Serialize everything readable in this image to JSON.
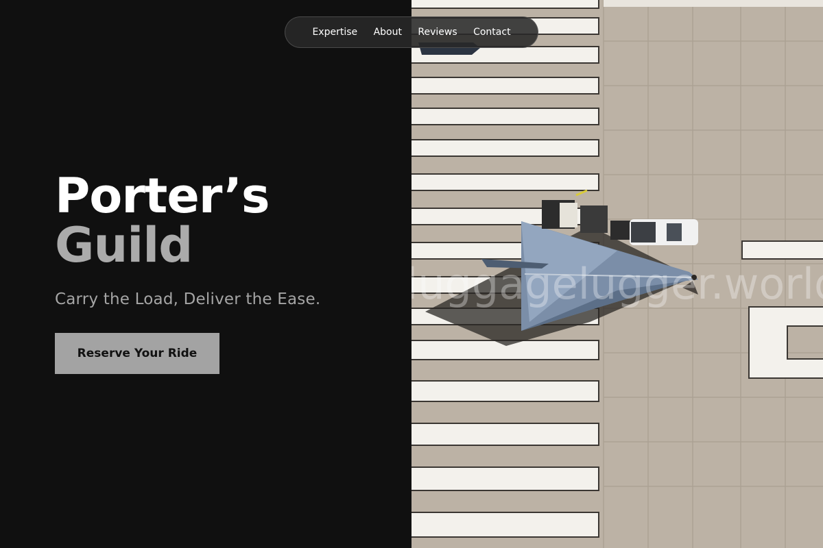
{
  "nav": {
    "items": [
      {
        "label": "Expertise"
      },
      {
        "label": "About"
      },
      {
        "label": "Reviews"
      },
      {
        "label": "Contact"
      }
    ]
  },
  "hero": {
    "title_line_1": "Porter’s",
    "title_line_2": "Guild",
    "tagline": "Carry the Load, Deliver the Ease.",
    "cta_label": "Reserve Your Ride",
    "watermark_text": "luggagelugger.world"
  },
  "colors": {
    "background": "#101010",
    "title_primary": "#ffffff",
    "title_secondary": "#ababab",
    "cta_background": "#a3a3a3",
    "nav_background": "#282828"
  },
  "icons": {
    "photo_subject": "aircraft-on-tarmac"
  }
}
